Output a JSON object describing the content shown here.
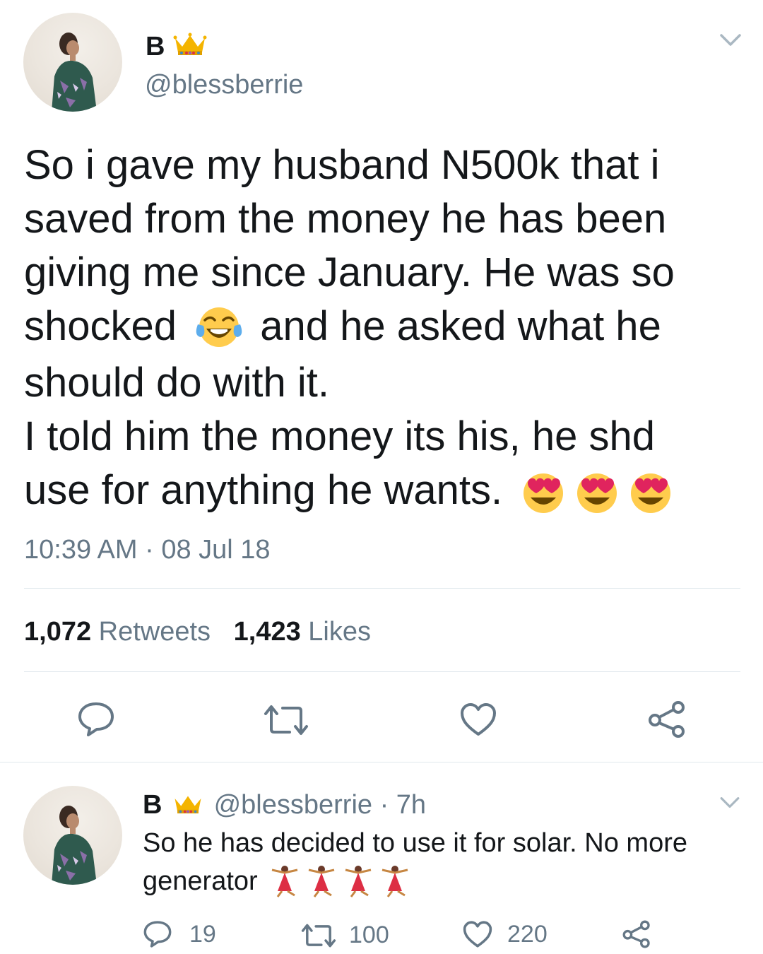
{
  "main_tweet": {
    "display_name": "B",
    "handle": "@blessberrie",
    "text_lines": [
      "So i gave my husband N500k that i",
      "saved from the money he has been",
      "giving me since January. He was so",
      "shocked",
      "and he asked what he",
      "should do with it.",
      "I told him the money its his, he shd",
      "use for anything he wants."
    ],
    "timestamp": "10:39 AM · 08 Jul 18",
    "retweets_count": "1,072",
    "retweets_label": "Retweets",
    "likes_count": "1,423",
    "likes_label": "Likes"
  },
  "reply_tweet": {
    "display_name": "B",
    "handle": "@blessberrie",
    "time": "· 7h",
    "text_line1": "So he has decided to use it for solar. No more",
    "text_line2": "generator",
    "reply_count": "19",
    "retweet_count": "100",
    "like_count": "220"
  },
  "icons": {
    "reply": "reply-bubble-icon",
    "retweet": "retweet-icon",
    "like": "heart-icon",
    "share": "share-icon",
    "menu": "chevron-down-icon",
    "crown": "crown-emoji-icon"
  },
  "colors": {
    "text": "#14171a",
    "muted": "#657786",
    "divider": "#e1e8ed",
    "icon": "#657786"
  }
}
